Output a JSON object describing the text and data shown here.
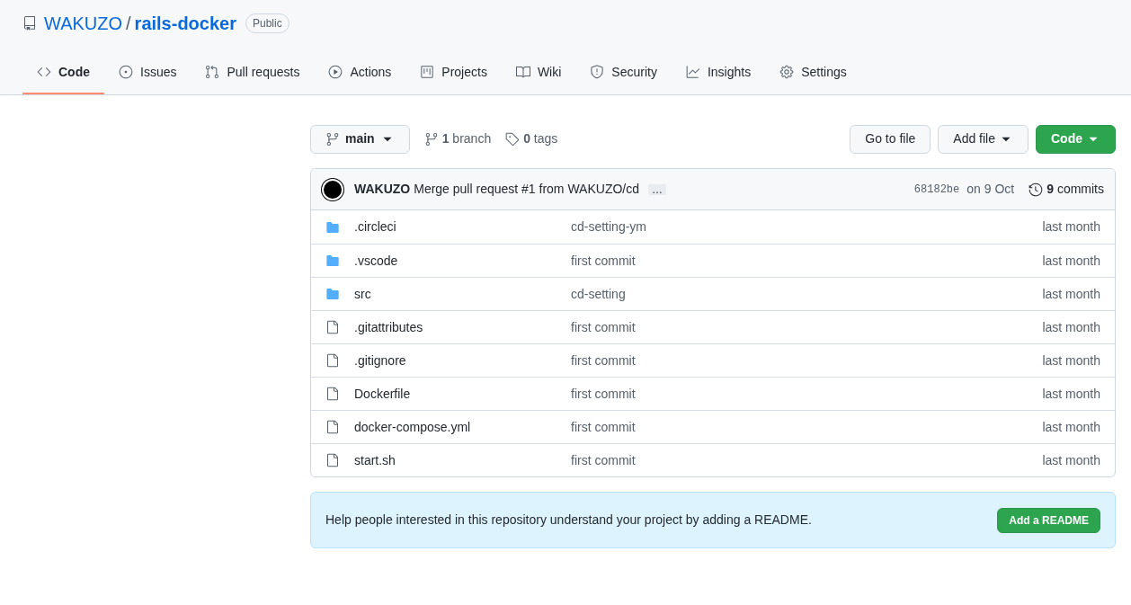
{
  "repo": {
    "owner": "WAKUZO",
    "separator": "/",
    "name": "rails-docker",
    "visibility": "Public"
  },
  "tabs": [
    {
      "label": "Code",
      "selected": true
    },
    {
      "label": "Issues",
      "selected": false
    },
    {
      "label": "Pull requests",
      "selected": false
    },
    {
      "label": "Actions",
      "selected": false
    },
    {
      "label": "Projects",
      "selected": false
    },
    {
      "label": "Wiki",
      "selected": false
    },
    {
      "label": "Security",
      "selected": false
    },
    {
      "label": "Insights",
      "selected": false
    },
    {
      "label": "Settings",
      "selected": false
    }
  ],
  "toolbar": {
    "branch": "main",
    "branches": "**1** branch",
    "tags": "**0** tags",
    "buttons": [
      "Go to file",
      "Add file",
      "Code"
    ]
  },
  "latest_commit": {
    "author": "WAKUZO",
    "message": "Merge pull request #1 from WAKUZO/cd",
    "more": "…",
    "sha": "68182be",
    "date": "on 9 Oct",
    "commits": "**9** commits"
  },
  "files": [
    {
      "kind": "folder",
      "name": ".circleci",
      "message": "cd-setting-ym",
      "age": "last month"
    },
    {
      "kind": "folder",
      "name": ".vscode",
      "message": "first commit",
      "age": "last month"
    },
    {
      "kind": "folder",
      "name": "src",
      "message": "cd-setting",
      "age": "last month"
    },
    {
      "kind": "file",
      "name": ".gitattributes",
      "message": "first commit",
      "age": "last month"
    },
    {
      "kind": "file",
      "name": ".gitignore",
      "message": "first commit",
      "age": "last month"
    },
    {
      "kind": "file",
      "name": "Dockerfile",
      "message": "first commit",
      "age": "last month"
    },
    {
      "kind": "file",
      "name": "docker-compose.yml",
      "message": "first commit",
      "age": "last month"
    },
    {
      "kind": "file",
      "name": "start.sh",
      "message": "first commit",
      "age": "last month"
    }
  ],
  "readme_prompt": {
    "text": "Help people interested in this repository understand your project by adding a README.",
    "button": "Add a README"
  }
}
